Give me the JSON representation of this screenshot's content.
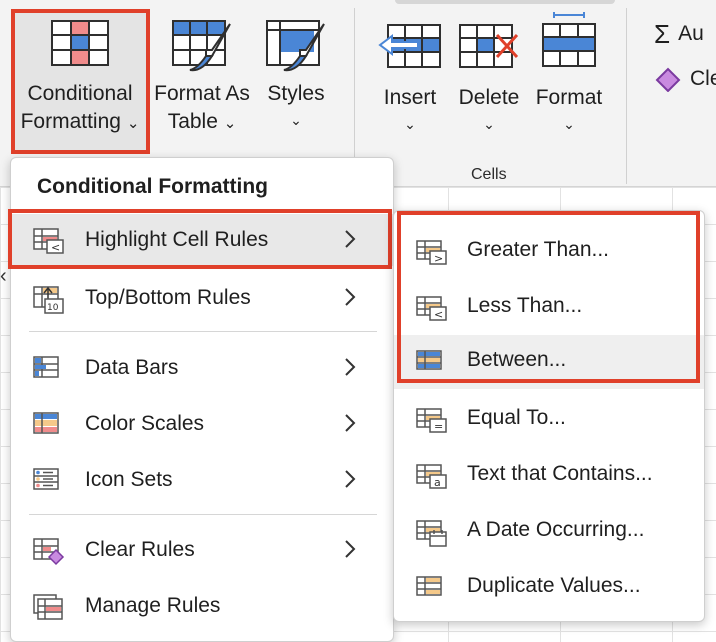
{
  "ribbon": {
    "conditional_formatting": {
      "line1": "Conditional",
      "line2": "Formatting",
      "chev": "⌄"
    },
    "format_as_table": {
      "line1": "Format As",
      "line2": "Table",
      "chev": "⌄"
    },
    "styles": {
      "line1": "Styles",
      "chev": "⌄"
    },
    "insert": {
      "label": "Insert",
      "chev": "⌄"
    },
    "delete": {
      "label": "Delete",
      "chev": "⌄"
    },
    "format": {
      "label": "Format",
      "chev": "⌄"
    },
    "group_label": "Cells",
    "autosum": {
      "label": "Au"
    },
    "clear": {
      "label": "Cle"
    }
  },
  "menu": {
    "title": "Conditional Formatting",
    "items": [
      {
        "label": "Highlight Cell Rules",
        "icon": "highlight-cell-rules-icon"
      },
      {
        "label": "Top/Bottom Rules",
        "icon": "top-bottom-rules-icon"
      },
      {
        "label": "Data Bars",
        "icon": "data-bars-icon"
      },
      {
        "label": "Color Scales",
        "icon": "color-scales-icon"
      },
      {
        "label": "Icon Sets",
        "icon": "icon-sets-icon"
      },
      {
        "label": "Clear Rules",
        "icon": "clear-rules-icon"
      },
      {
        "label": "Manage Rules",
        "icon": "manage-rules-icon"
      }
    ]
  },
  "submenu": {
    "items": [
      {
        "label": "Greater Than...",
        "icon": "greater-than-icon"
      },
      {
        "label": "Less Than...",
        "icon": "less-than-icon"
      },
      {
        "label": "Between...",
        "icon": "between-icon"
      },
      {
        "label": "Equal To...",
        "icon": "equal-to-icon"
      },
      {
        "label": "Text that Contains...",
        "icon": "text-contains-icon"
      },
      {
        "label": "A Date Occurring...",
        "icon": "date-occurring-icon"
      },
      {
        "label": "Duplicate Values...",
        "icon": "duplicate-values-icon"
      }
    ]
  },
  "colors": {
    "highlight_border": "#e0402a",
    "icon_blue": "#4a86d6",
    "icon_red": "#f08c8c",
    "icon_orange": "#f5c98a"
  }
}
